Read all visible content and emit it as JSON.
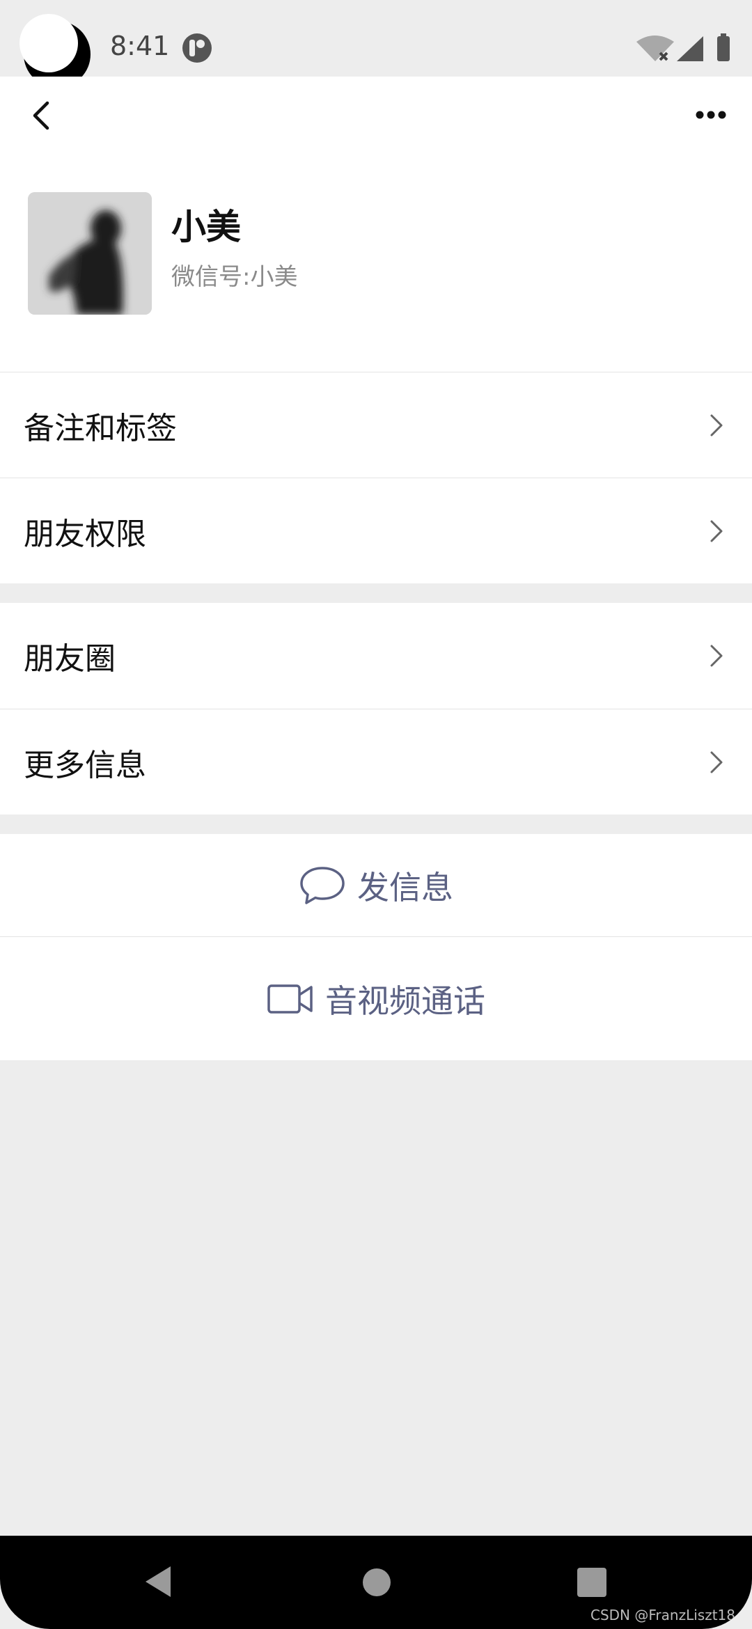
{
  "status_bar": {
    "time": "8:41",
    "icons": [
      "moon-icon",
      "app-notification-icon",
      "wifi-off-icon",
      "signal-icon",
      "battery-icon"
    ]
  },
  "topbar": {
    "back_icon": "chevron-left-icon",
    "more_icon": "more-horizontal-icon"
  },
  "profile": {
    "name": "小美",
    "wechat_id": "微信号:小美"
  },
  "sections": [
    {
      "label": "备注和标签"
    },
    {
      "label": "朋友权限"
    },
    {
      "label": "朋友圈"
    },
    {
      "label": "更多信息"
    }
  ],
  "actions": {
    "message": "发信息",
    "video_call": "音视频通话"
  },
  "watermark": "CSDN @FranzLiszt18",
  "colors": {
    "background": "#ededed",
    "action_text": "#5b6183",
    "text_primary": "#111111",
    "text_secondary": "#8a8a8a"
  }
}
